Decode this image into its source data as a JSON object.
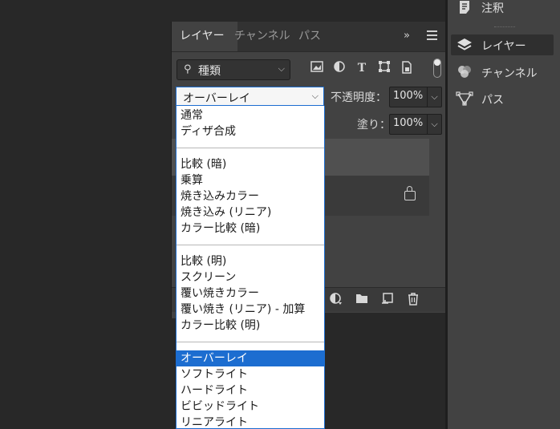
{
  "layers_panel": {
    "tabs": [
      {
        "label": "レイヤー",
        "active": true
      },
      {
        "label": "チャンネル",
        "active": false
      },
      {
        "label": "パス",
        "active": false
      }
    ],
    "collapse_glyph": "»",
    "filter": {
      "search_icon": "⚲",
      "value": "種類",
      "chevron": "⌵"
    },
    "opacity": {
      "label": "不透明度：",
      "value": "100%"
    },
    "fill": {
      "label": "塗り：",
      "value": "100%"
    }
  },
  "right_panel": {
    "items": [
      {
        "label": "注釈",
        "icon": "note-icon"
      },
      {
        "label": "レイヤー",
        "icon": "layers-icon",
        "active": true
      },
      {
        "label": "チャンネル",
        "icon": "channels-icon"
      },
      {
        "label": "パス",
        "icon": "paths-icon"
      }
    ]
  },
  "blend_mode": {
    "current": "オーバーレイ",
    "chevron": "⌵",
    "groups": [
      [
        "通常",
        "ディザ合成"
      ],
      [
        "比較 (暗)",
        "乗算",
        "焼き込みカラー",
        "焼き込み (リニア)",
        "カラー比較 (暗)"
      ],
      [
        "比較 (明)",
        "スクリーン",
        "覆い焼きカラー",
        "覆い焼き (リニア) - 加算",
        "カラー比較 (明)"
      ],
      [
        "オーバーレイ",
        "ソフトライト",
        "ハードライト",
        "ビビッドライト",
        "リニアライト"
      ]
    ],
    "selected": "オーバーレイ"
  },
  "colors": {
    "accent": "#1c6dd0",
    "panel": "#424242",
    "background": "#282828"
  }
}
